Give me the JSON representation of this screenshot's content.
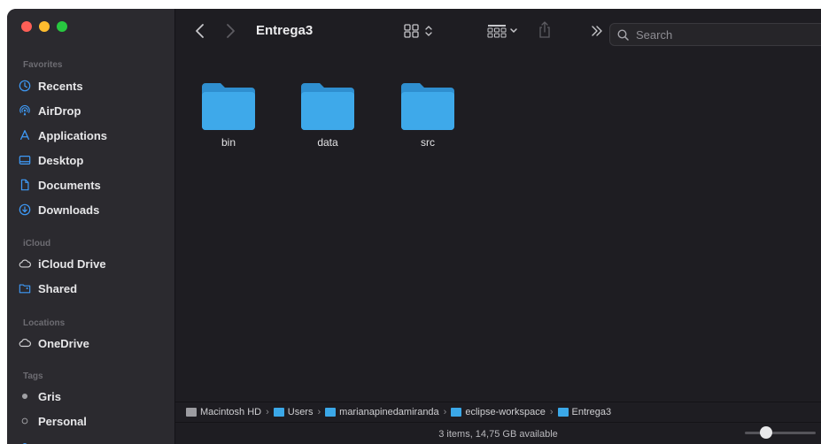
{
  "window": {
    "title": "Entrega3"
  },
  "sidebar": {
    "favorites_header": "Favorites",
    "favorites": [
      {
        "label": "Recents",
        "icon": "clock-icon"
      },
      {
        "label": "AirDrop",
        "icon": "airdrop-icon"
      },
      {
        "label": "Applications",
        "icon": "applications-icon"
      },
      {
        "label": "Desktop",
        "icon": "desktop-icon"
      },
      {
        "label": "Documents",
        "icon": "document-icon"
      },
      {
        "label": "Downloads",
        "icon": "download-icon"
      }
    ],
    "icloud_header": "iCloud",
    "icloud": [
      {
        "label": "iCloud Drive",
        "icon": "cloud-icon"
      },
      {
        "label": "Shared",
        "icon": "shared-folder-icon"
      }
    ],
    "locations_header": "Locations",
    "locations": [
      {
        "label": "OneDrive",
        "icon": "cloud-icon"
      }
    ],
    "tags_header": "Tags",
    "tags": [
      {
        "label": "Gris",
        "color": "#a0a0a4",
        "filled": true
      },
      {
        "label": "Personal",
        "color": "#a0a0a4",
        "filled": false
      }
    ]
  },
  "toolbar": {
    "search_placeholder": "Search"
  },
  "files": [
    {
      "name": "bin"
    },
    {
      "name": "data"
    },
    {
      "name": "src"
    }
  ],
  "pathbar": {
    "crumbs": [
      "Macintosh HD",
      "Users",
      "marianapinedamiranda",
      "eclipse-workspace",
      "Entrega3"
    ]
  },
  "status": {
    "text": "3 items, 14,75 GB available",
    "icon_size_level": 0.25
  },
  "colors": {
    "folder": "#3ea9ea",
    "accent": "#3e9af7"
  }
}
